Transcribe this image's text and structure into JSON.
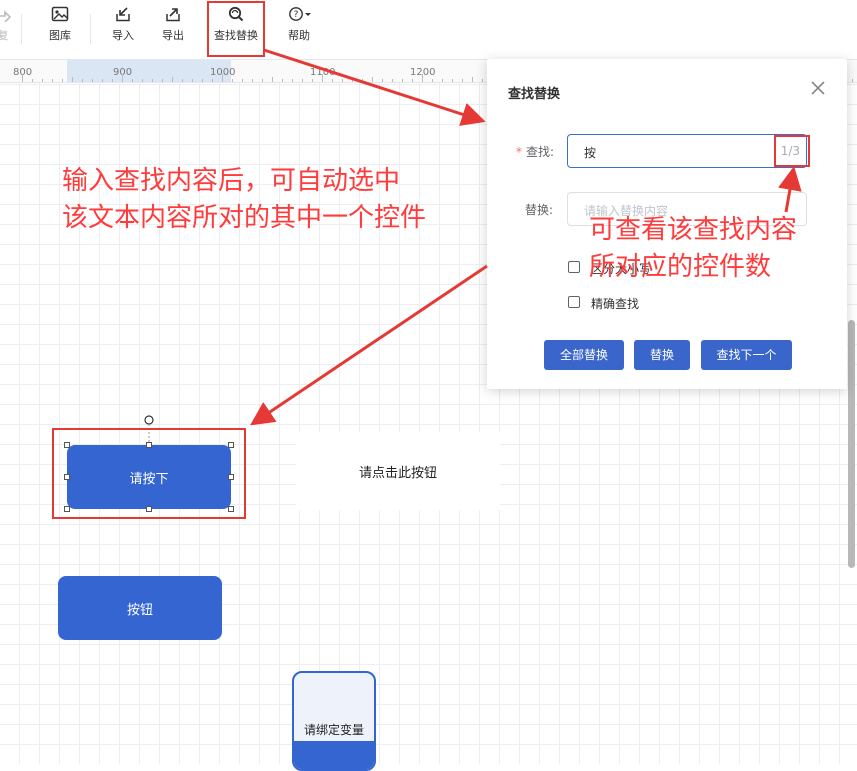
{
  "toolbar": {
    "items": [
      {
        "label": "复"
      },
      {
        "label": "图库"
      },
      {
        "label": "导入"
      },
      {
        "label": "导出"
      },
      {
        "label": "查找替换"
      },
      {
        "label": "帮助"
      }
    ]
  },
  "ruler": {
    "labels": [
      "800",
      "900",
      "1000",
      "1100",
      "1200"
    ]
  },
  "find_replace": {
    "title": "查找替换",
    "find_label": "查找:",
    "find_value": "按",
    "match_counter": "1/3",
    "replace_label": "替换:",
    "replace_placeholder": "请输入替换内容",
    "option_1_label": "区分大小写",
    "option_2_label": "精确查找",
    "replace_all_label": "全部替换",
    "replace_label_button": "替换",
    "find_next_label": "查找下一个"
  },
  "canvas": {
    "selected_button_label": "请按下",
    "text_widget_label": "请点击此按钮",
    "button_label": "按钮",
    "variable_widget_label": "请绑定变量"
  },
  "annotations": {
    "left_line1": "输入查找内容后，可自动选中",
    "left_line2": "该文本内容所对的其中一个控件",
    "right_line1": "可查看该查找内容",
    "right_line2": "所对应的控件数"
  },
  "colors": {
    "accent": "#3565d0",
    "annotation": "#ff3b3b"
  }
}
